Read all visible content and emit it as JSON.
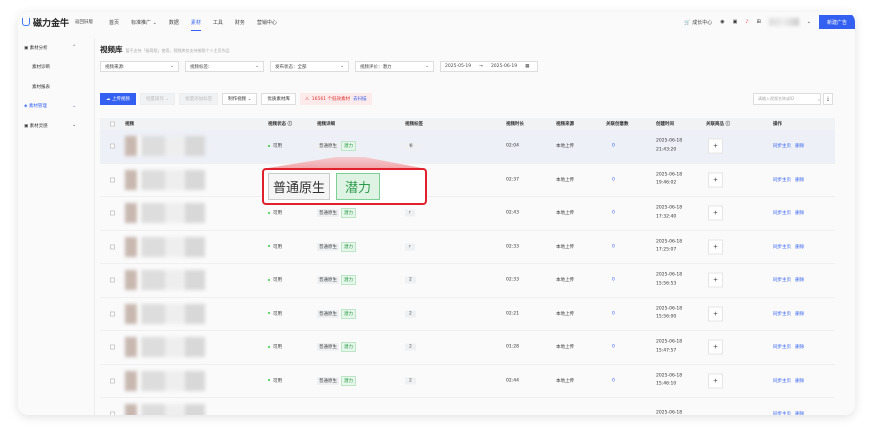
{
  "app": {
    "logo": "磁力金牛",
    "return": "返回旧版",
    "nav": [
      "首页",
      "标准推广",
      "数据",
      "素材",
      "工具",
      "财务",
      "营销中心"
    ],
    "nav_active": 3,
    "growth": "成长中心",
    "new_ad": "新建广告"
  },
  "sidebar": [
    {
      "label": "素材分析",
      "type": "group"
    },
    {
      "label": "素材诊断",
      "type": "sub"
    },
    {
      "label": "素材报表",
      "type": "sub"
    },
    {
      "label": "素材管理",
      "type": "group",
      "active": true
    },
    {
      "label": "素材灵感",
      "type": "group"
    }
  ],
  "page": {
    "title": "视频库",
    "hint": "暂不支持「极简版」使用，视频库仅支持按照个人主页作品"
  },
  "filters": {
    "source": "视频来源:",
    "tag": "视频标签:",
    "status": "发布状态：全部",
    "rating": "视频评价：潜力",
    "date_start": "2025-05-19",
    "date_sep": "→",
    "date_end": "2025-06-19"
  },
  "actions": {
    "upload": "上传视频",
    "batch": "批量操作",
    "batch_tag": "批量添加标签",
    "make": "制作视频",
    "quality": "优质素材库",
    "warn_count": "16561",
    "warn_text": "个低效素材",
    "warn_link": "去扫描",
    "search_placeholder": "请输入视频名称或ID"
  },
  "columns": [
    "视频",
    "视频状态 ⓘ",
    "视频详细",
    "视频标签",
    "视频时长",
    "视频来源",
    "关联创意数",
    "创建时间",
    "关联商品 ⓘ",
    "操作"
  ],
  "rows": [
    {
      "status": "可用",
      "type": "普通原生",
      "rating": "潜力",
      "tag": "补",
      "duration": "02:04",
      "source": "本地上传",
      "creatives": "0",
      "date": "2025-06-18",
      "time": "21:43:20"
    },
    {
      "status": "可用",
      "type": "普通原生",
      "rating": "潜力",
      "tag": "",
      "duration": "02:37",
      "source": "本地上传",
      "creatives": "0",
      "date": "2025-06-18",
      "time": "19:46:02"
    },
    {
      "status": "可用",
      "type": "普通原生",
      "rating": "潜力",
      "tag": "r",
      "duration": "02:43",
      "source": "本地上传",
      "creatives": "0",
      "date": "2025-06-18",
      "time": "17:32:40"
    },
    {
      "status": "可用",
      "type": "普通原生",
      "rating": "潜力",
      "tag": "r",
      "duration": "02:33",
      "source": "本地上传",
      "creatives": "0",
      "date": "2025-06-18",
      "time": "17:25:07"
    },
    {
      "status": "可用",
      "type": "普通原生",
      "rating": "潜力",
      "tag": "2",
      "duration": "02:33",
      "source": "本地上传",
      "creatives": "0",
      "date": "2025-06-18",
      "time": "15:56:53"
    },
    {
      "status": "可用",
      "type": "普通原生",
      "rating": "潜力",
      "tag": "2",
      "duration": "02:21",
      "source": "本地上传",
      "creatives": "0",
      "date": "2025-06-18",
      "time": "15:56:00"
    },
    {
      "status": "可用",
      "type": "普通原生",
      "rating": "潜力",
      "tag": "2",
      "duration": "01:28",
      "source": "本地上传",
      "creatives": "0",
      "date": "2025-06-18",
      "time": "15:47:57"
    },
    {
      "status": "可用",
      "type": "普通原生",
      "rating": "潜力",
      "tag": "2",
      "duration": "02:44",
      "source": "本地上传",
      "creatives": "0",
      "date": "2025-06-18",
      "time": "15:46:10"
    },
    {
      "status": "",
      "type": "",
      "rating": "",
      "tag": "",
      "duration": "",
      "source": "",
      "creatives": "",
      "date": "2025-06-18",
      "time": ""
    }
  ],
  "row_actions": {
    "sync": "同步主页",
    "delete": "删除"
  },
  "callout": {
    "type": "普通原生",
    "rating": "潜力"
  }
}
